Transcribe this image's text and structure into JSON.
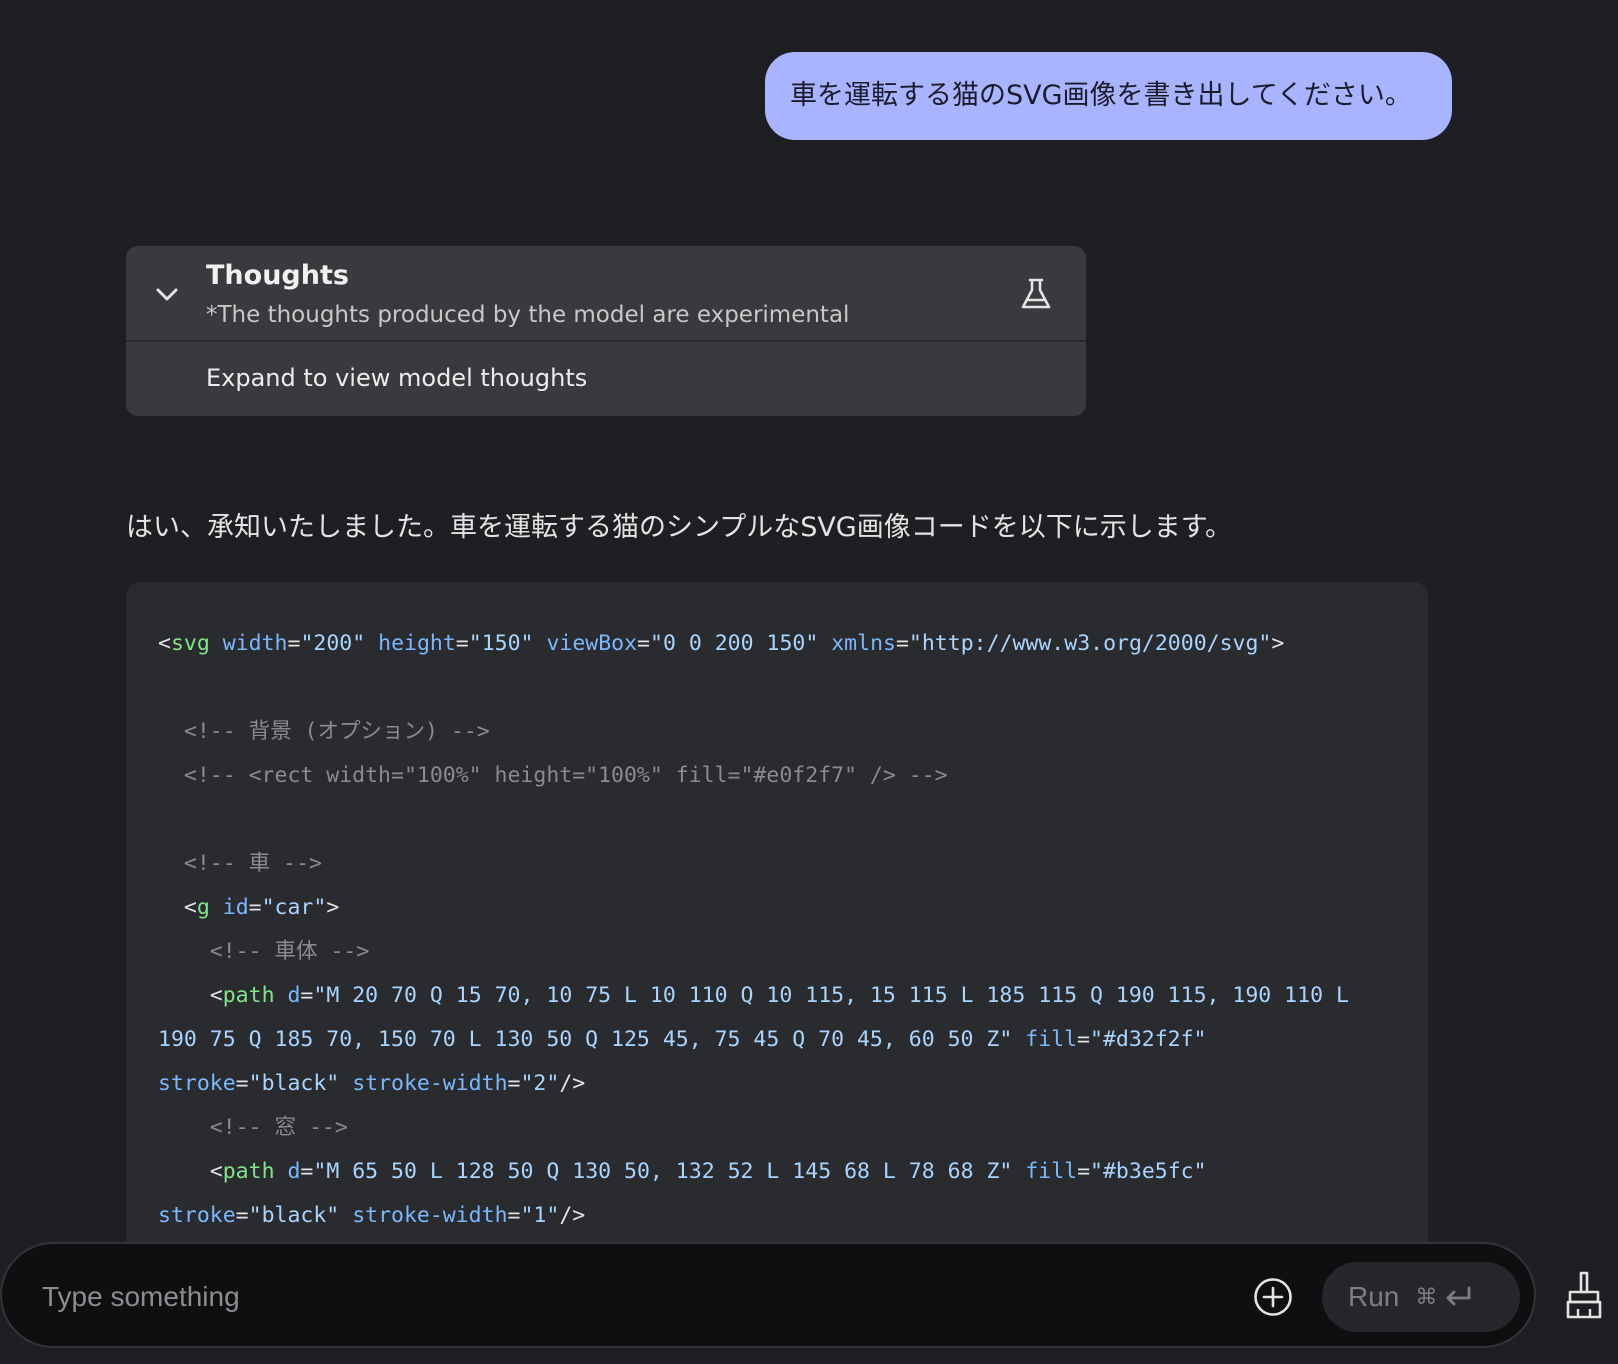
{
  "conversation": {
    "user_message": "車を運転する猫のSVG画像を書き出してください。",
    "thoughts": {
      "title": "Thoughts",
      "subtitle": "*The thoughts produced by the model are experimental",
      "expand_label": "Expand to view model thoughts",
      "icons": {
        "toggle": "chevron-down-icon",
        "badge": "flask-icon"
      }
    },
    "response_text": "はい、承知いたしました。車を運転する猫のシンプルなSVG画像コードを以下に示します。",
    "code_lines": [
      "<svg width=\"200\" height=\"150\" viewBox=\"0 0 200 150\" xmlns=\"http://www.w3.org/2000/svg\">",
      "",
      "  <!-- 背景 (オプション) -->",
      "  <!-- <rect width=\"100%\" height=\"100%\" fill=\"#e0f2f7\" /> -->",
      "",
      "  <!-- 車 -->",
      "  <g id=\"car\">",
      "    <!-- 車体 -->",
      "    <path d=\"M 20 70 Q 15 70, 10 75 L 10 110 Q 10 115, 15 115 L 185 115 Q 190 115, 190 110 L",
      "190 75 Q 185 70, 150 70 L 130 50 Q 125 45, 75 45 Q 70 45, 60 50 Z\" fill=\"#d32f2f\"",
      "stroke=\"black\" stroke-width=\"2\"/>",
      "    <!-- 窓 -->",
      "    <path d=\"M 65 50 L 128 50 Q 130 50, 132 52 L 145 68 L 78 68 Z\" fill=\"#b3e5fc\"",
      "stroke=\"black\" stroke-width=\"1\"/>"
    ]
  },
  "input": {
    "placeholder": "Type something",
    "value": ""
  },
  "toolbar": {
    "run_label": "Run",
    "run_shortcut_symbol": "⌘",
    "icons": {
      "add": "add-circle-icon",
      "enter": "enter-icon",
      "clear": "broom-icon"
    }
  },
  "colors": {
    "background": "#1e1f22",
    "user_bubble": "#a8b4ff",
    "thoughts_panel": "#393a3e",
    "code_background": "#2a2b2e",
    "tag": "#7ee787",
    "attribute": "#79b8ff",
    "string": "#a8d4ff",
    "comment": "#8a8b8e"
  }
}
